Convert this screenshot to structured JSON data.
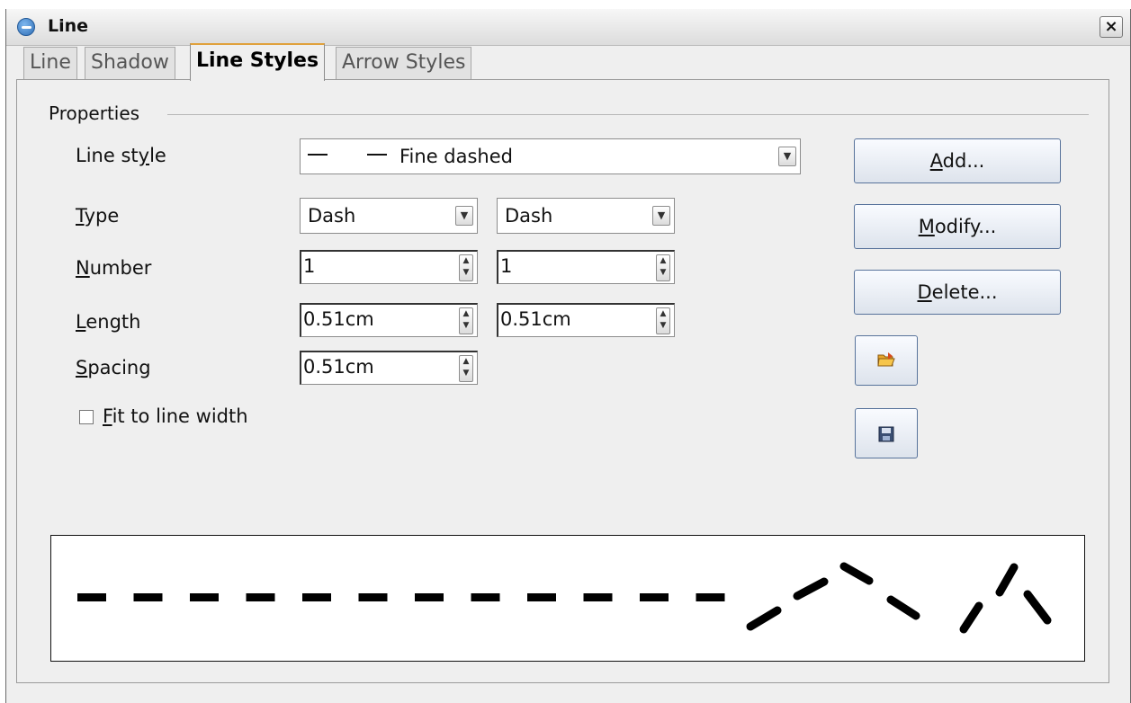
{
  "window": {
    "title": "Line",
    "close_label": "×"
  },
  "tabs": [
    "Line",
    "Shadow",
    "Line Styles",
    "Arrow Styles"
  ],
  "properties": {
    "group_label": "Properties",
    "line_style": {
      "label_pre": "Line st",
      "label_accel": "y",
      "label_post": "le",
      "value": "Fine dashed"
    },
    "type": {
      "label_accel": "T",
      "label_post": "ype",
      "value1": "Dash",
      "value2": "Dash"
    },
    "number": {
      "label_accel": "N",
      "label_post": "umber",
      "value1": "1",
      "value2": "1"
    },
    "length": {
      "label_accel": "L",
      "label_post": "ength",
      "value1": "0.51cm",
      "value2": "0.51cm"
    },
    "spacing": {
      "label_accel": "S",
      "label_post": "pacing",
      "value": "0.51cm"
    },
    "fit_to_line_width": {
      "label_accel": "F",
      "label_post": "it to line width",
      "checked": false
    }
  },
  "buttons": {
    "add": {
      "accel": "A",
      "rest": "dd..."
    },
    "modify": {
      "accel": "M",
      "rest": "odify..."
    },
    "delete": {
      "accel": "D",
      "rest": "elete..."
    },
    "load_icon": "open-folder-icon",
    "save_icon": "floppy-disk-icon"
  },
  "preview": {
    "style": "dashed",
    "dash_color": "#000000"
  }
}
